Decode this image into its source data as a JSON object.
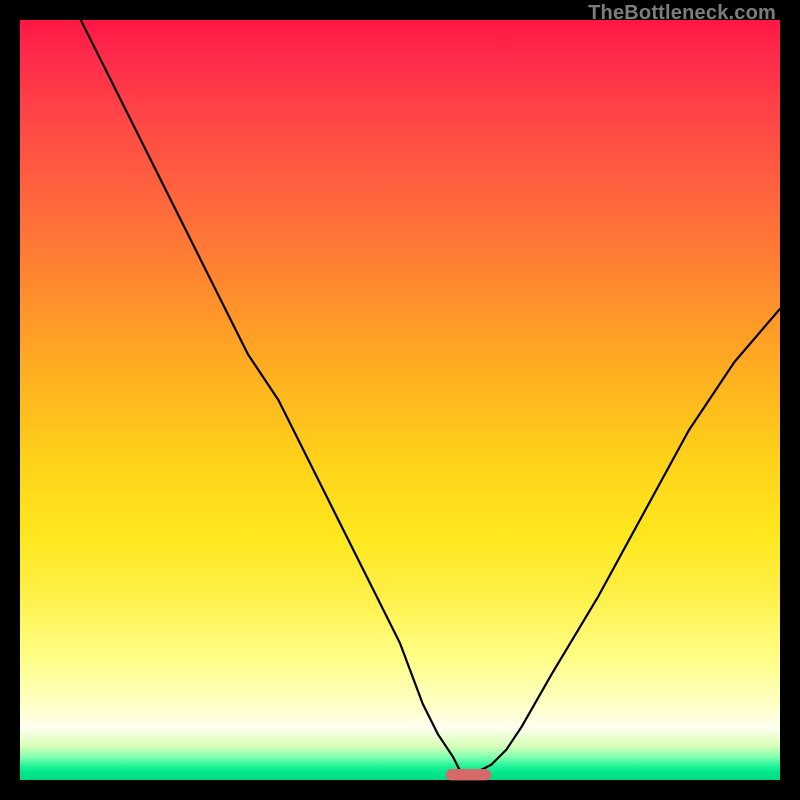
{
  "watermark": "TheBottleneck.com",
  "chart_data": {
    "type": "line",
    "title": "",
    "xlabel": "",
    "ylabel": "",
    "xlim": [
      0,
      100
    ],
    "ylim": [
      0,
      100
    ],
    "x": [
      8,
      12,
      18,
      24,
      30,
      34,
      38,
      42,
      46,
      50,
      53,
      55,
      57,
      58,
      60,
      62,
      64,
      66,
      70,
      76,
      82,
      88,
      94,
      100
    ],
    "y": [
      100,
      92,
      80,
      68,
      56,
      50,
      42,
      34,
      26,
      18,
      10,
      6,
      3,
      1,
      1,
      2,
      4,
      7,
      14,
      24,
      35,
      46,
      55,
      62
    ],
    "marker": {
      "x_center": 59,
      "y": 0.7,
      "width": 6,
      "height": 1.5
    },
    "colors": {
      "gradient_top": "#ff1744",
      "gradient_mid": "#ffd21a",
      "gradient_bottom": "#00d980",
      "curve": "#000000",
      "marker": "#d66a6a",
      "frame": "#000000"
    }
  }
}
